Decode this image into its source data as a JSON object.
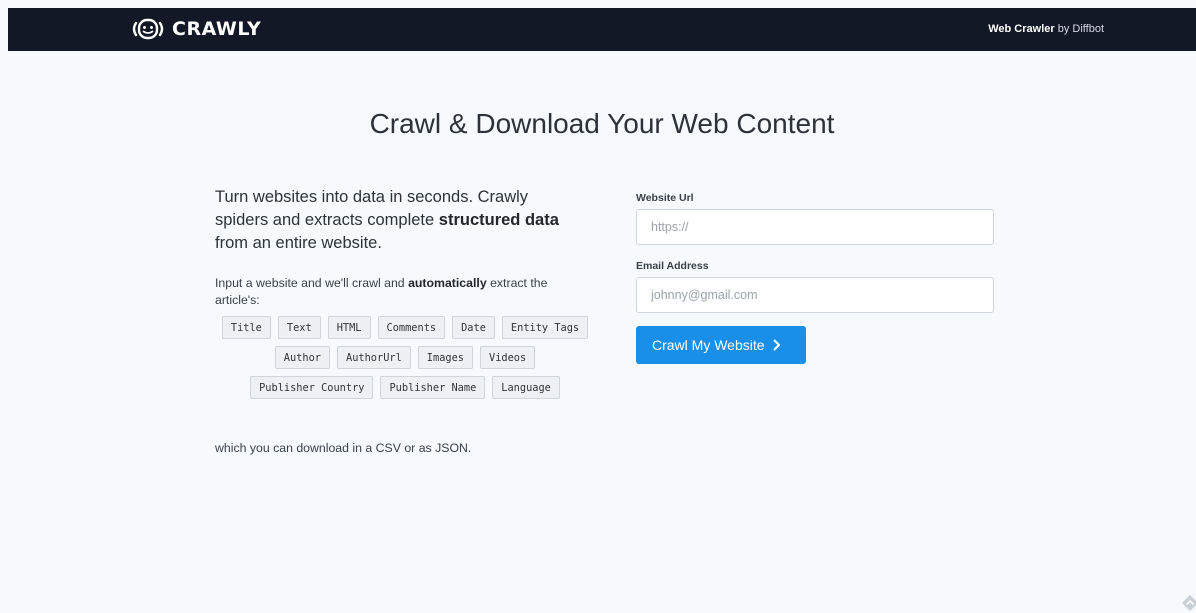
{
  "header": {
    "brand": "CRAWLY",
    "tagline_strong": "Web Crawler",
    "tagline_rest": " by Diffbot",
    "icons": {
      "logo": "robot-face-icon"
    }
  },
  "hero": {
    "title": "Crawl & Download Your Web Content"
  },
  "intro": {
    "lede_part1": "Turn websites into data in seconds. Crawly spiders and extracts complete ",
    "lede_bold": "structured data",
    "lede_part2": " from an entire website.",
    "desc_part1": "Input a website and we'll crawl and ",
    "desc_bold": "automatically",
    "desc_part2": " extract the article's:",
    "tags": [
      "Title",
      "Text",
      "HTML",
      "Comments",
      "Date",
      "Entity Tags",
      "Author",
      "AuthorUrl",
      "Images",
      "Videos",
      "Publisher Country",
      "Publisher Name",
      "Language"
    ],
    "outro": "which you can download in a CSV or as JSON."
  },
  "form": {
    "url_label": "Website Url",
    "url_placeholder": "https://",
    "email_label": "Email Address",
    "email_placeholder": "johnny@gmail.com",
    "submit_label": "Crawl My Website",
    "icons": {
      "submit": "chevron-right-icon"
    }
  },
  "colors": {
    "topbar_bg": "#121825",
    "page_bg": "#f6fafd",
    "button_bg": "#1a8fe9",
    "tag_bg": "#eef1f4"
  },
  "icons": {
    "corner": "scroll-arrow-icon"
  }
}
